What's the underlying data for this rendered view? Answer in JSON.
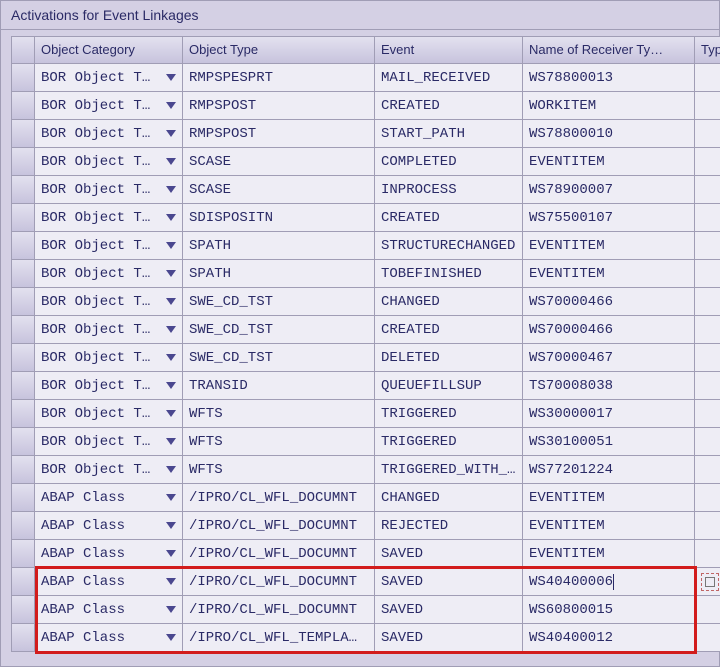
{
  "panel": {
    "title": "Activations for Event Linkages"
  },
  "columns": {
    "cat": "Object Category",
    "type": "Object Type",
    "event": "Event",
    "recv": "Name of Receiver Ty…",
    "typ": "Typ"
  },
  "rows": [
    {
      "cat": "BOR Object T…",
      "type": "RMPSPESPRT",
      "event": "MAIL_RECEIVED",
      "recv": "WS78800013"
    },
    {
      "cat": "BOR Object T…",
      "type": "RMPSPOST",
      "event": "CREATED",
      "recv": "WORKITEM"
    },
    {
      "cat": "BOR Object T…",
      "type": "RMPSPOST",
      "event": "START_PATH",
      "recv": "WS78800010"
    },
    {
      "cat": "BOR Object T…",
      "type": "SCASE",
      "event": "COMPLETED",
      "recv": "EVENTITEM"
    },
    {
      "cat": "BOR Object T…",
      "type": "SCASE",
      "event": "INPROCESS",
      "recv": "WS78900007"
    },
    {
      "cat": "BOR Object T…",
      "type": "SDISPOSITN",
      "event": "CREATED",
      "recv": "WS75500107"
    },
    {
      "cat": "BOR Object T…",
      "type": "SPATH",
      "event": "STRUCTURECHANGED",
      "recv": "EVENTITEM"
    },
    {
      "cat": "BOR Object T…",
      "type": "SPATH",
      "event": "TOBEFINISHED",
      "recv": "EVENTITEM"
    },
    {
      "cat": "BOR Object T…",
      "type": "SWE_CD_TST",
      "event": "CHANGED",
      "recv": "WS70000466"
    },
    {
      "cat": "BOR Object T…",
      "type": "SWE_CD_TST",
      "event": "CREATED",
      "recv": "WS70000466"
    },
    {
      "cat": "BOR Object T…",
      "type": "SWE_CD_TST",
      "event": "DELETED",
      "recv": "WS70000467"
    },
    {
      "cat": "BOR Object T…",
      "type": "TRANSID",
      "event": "QUEUEFILLSUP",
      "recv": "TS70008038"
    },
    {
      "cat": "BOR Object T…",
      "type": "WFTS",
      "event": "TRIGGERED",
      "recv": "WS30000017"
    },
    {
      "cat": "BOR Object T…",
      "type": "WFTS",
      "event": "TRIGGERED",
      "recv": "WS30100051"
    },
    {
      "cat": "BOR Object T…",
      "type": "WFTS",
      "event": "TRIGGERED_WITH_…",
      "recv": "WS77201224"
    },
    {
      "cat": "ABAP Class",
      "type": "/IPRO/CL_WFL_DOCUMNT",
      "event": "CHANGED",
      "recv": "EVENTITEM"
    },
    {
      "cat": "ABAP Class",
      "type": "/IPRO/CL_WFL_DOCUMNT",
      "event": "REJECTED",
      "recv": "EVENTITEM"
    },
    {
      "cat": "ABAP Class",
      "type": "/IPRO/CL_WFL_DOCUMNT",
      "event": "SAVED",
      "recv": "EVENTITEM"
    },
    {
      "cat": "ABAP Class",
      "type": "/IPRO/CL_WFL_DOCUMNT",
      "event": "SAVED",
      "recv": "WS40400006",
      "cursor": true
    },
    {
      "cat": "ABAP Class",
      "type": "/IPRO/CL_WFL_DOCUMNT",
      "event": "SAVED",
      "recv": "WS60800015"
    },
    {
      "cat": "ABAP Class",
      "type": "/IPRO/CL_WFL_TEMPLA…",
      "event": "SAVED",
      "recv": "WS40400012"
    }
  ],
  "highlight": {
    "fromRow": 18,
    "toRow": 20
  }
}
